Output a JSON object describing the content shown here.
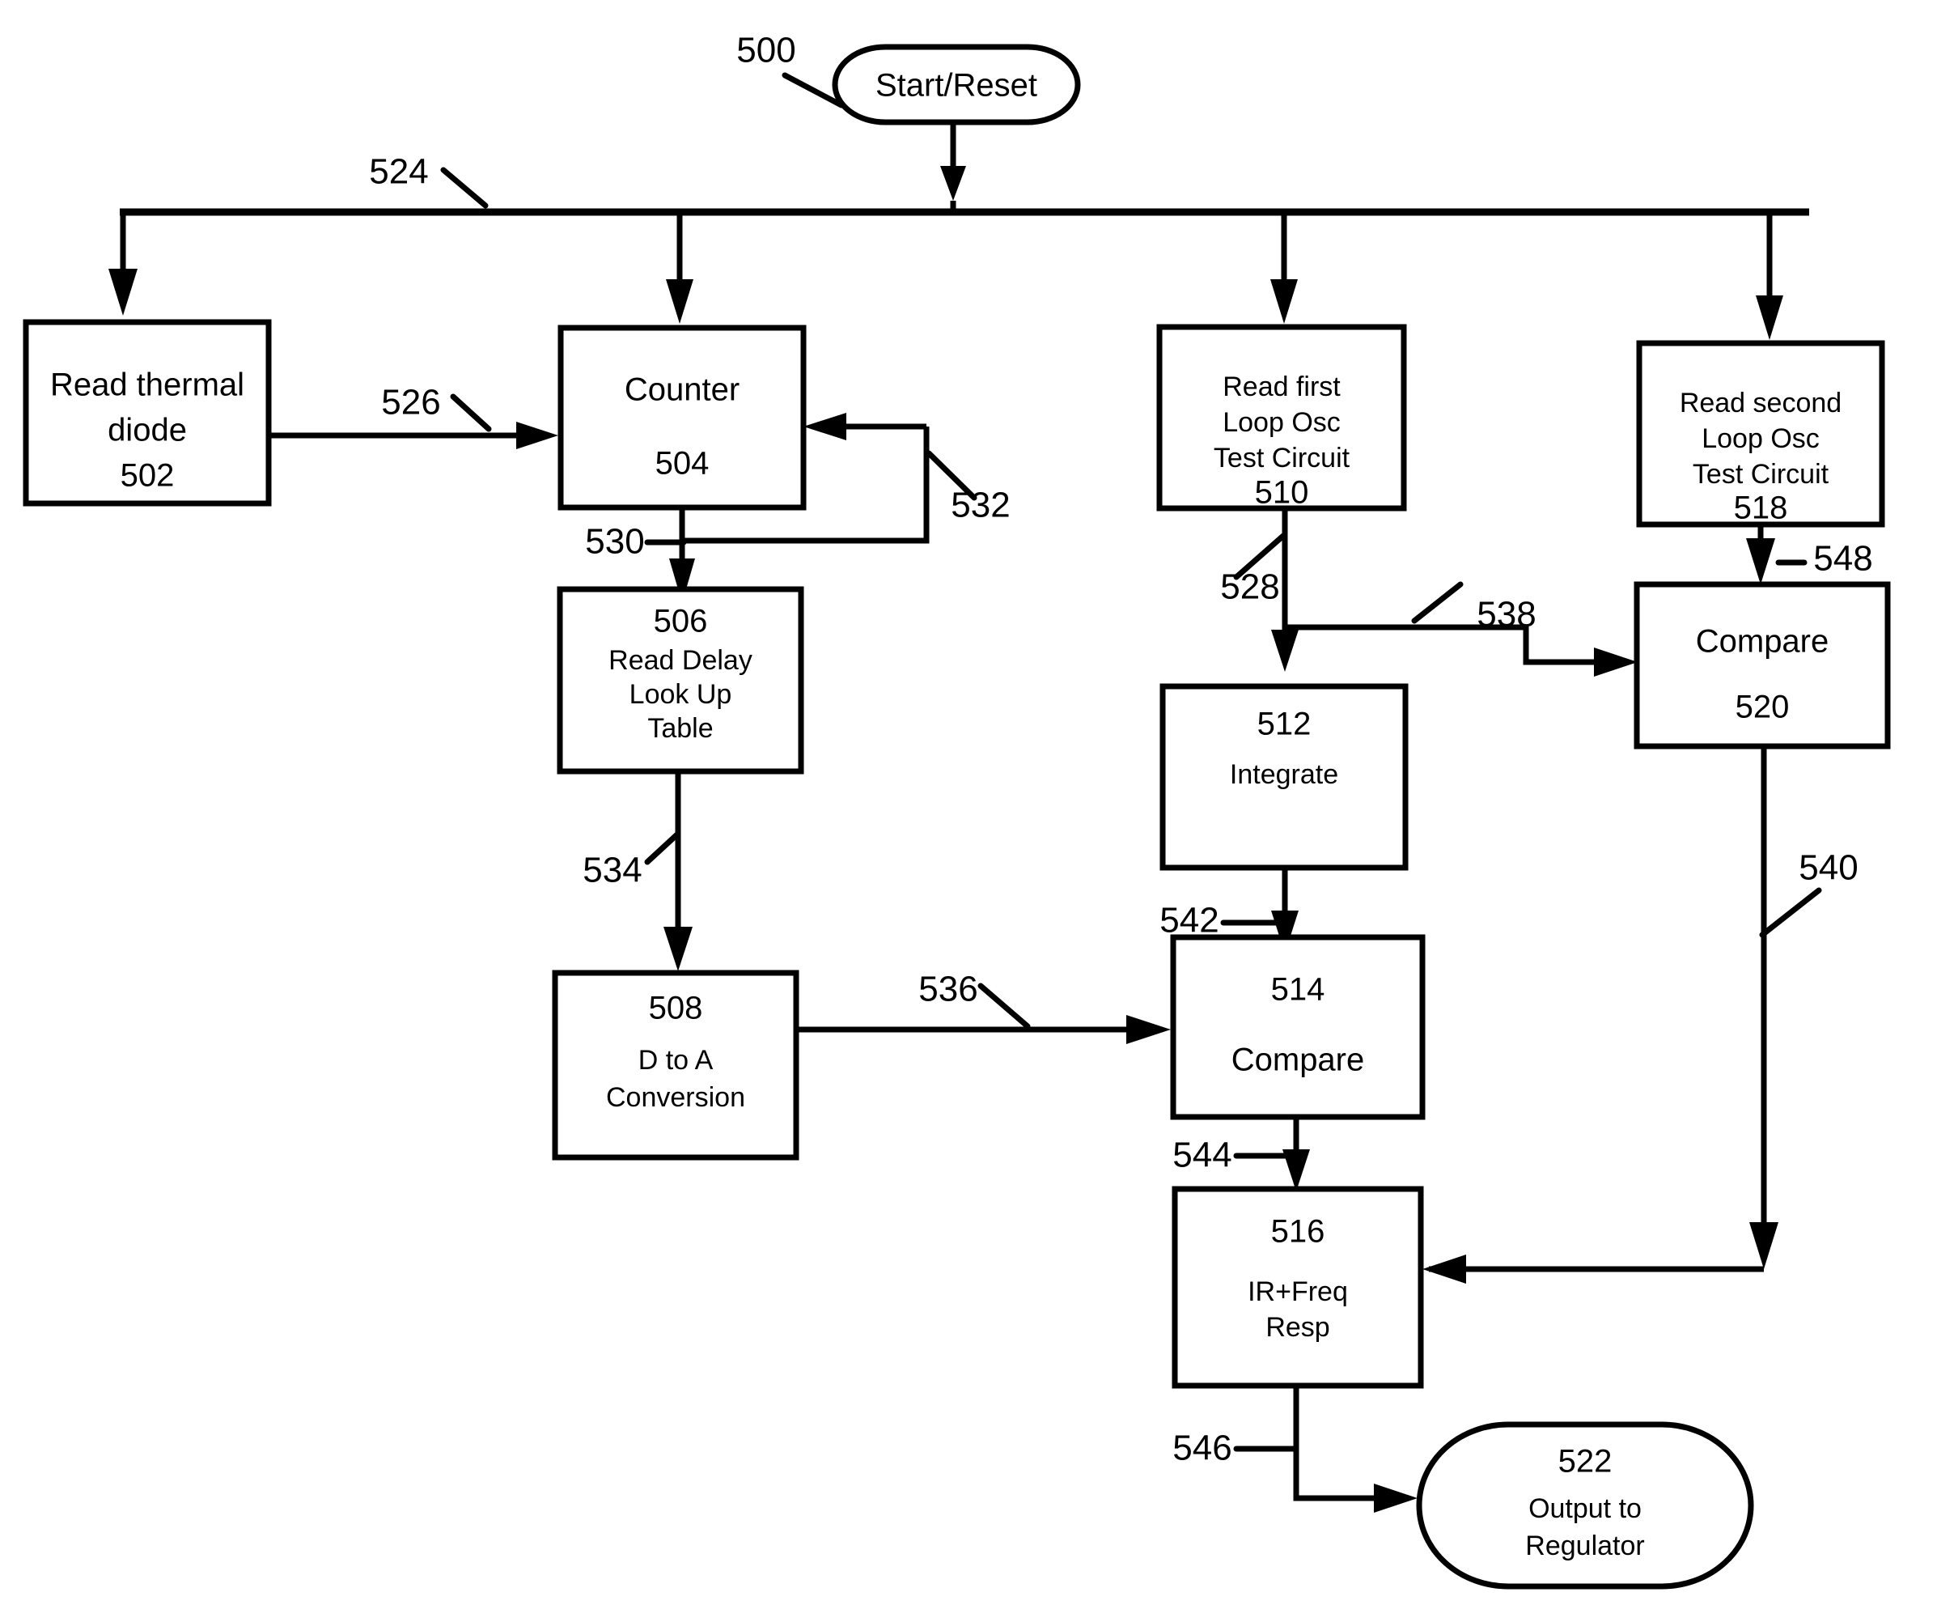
{
  "figure": {
    "type": "patent-flowchart",
    "figure_ref": "500"
  },
  "nodes": {
    "start": {
      "id": "500",
      "shape": "rounded-terminal",
      "label": "Start/Reset"
    },
    "n502": {
      "id": "502",
      "shape": "rectangle",
      "line1": "Read thermal",
      "line2": "diode",
      "number": "502"
    },
    "n504": {
      "id": "504",
      "shape": "rectangle",
      "label": "Counter",
      "number": "504"
    },
    "n506": {
      "id": "506",
      "shape": "rectangle",
      "number": "506",
      "line1": "Read Delay",
      "line2": "Look Up",
      "line3": "Table"
    },
    "n508": {
      "id": "508",
      "shape": "rectangle",
      "number": "508",
      "line1": "D to A",
      "line2": "Conversion"
    },
    "n510": {
      "id": "510",
      "shape": "rectangle",
      "line1": "Read first",
      "line2": "Loop Osc",
      "line3": "Test Circuit",
      "number": "510"
    },
    "n512": {
      "id": "512",
      "shape": "rectangle",
      "number": "512",
      "label": "Integrate"
    },
    "n514": {
      "id": "514",
      "shape": "rectangle",
      "number": "514",
      "label": "Compare"
    },
    "n516": {
      "id": "516",
      "shape": "rectangle",
      "number": "516",
      "line1": "IR+Freq",
      "line2": "Resp"
    },
    "n518": {
      "id": "518",
      "shape": "rectangle",
      "line1": "Read second",
      "line2": "Loop Osc",
      "line3": "Test Circuit",
      "number": "518"
    },
    "n520": {
      "id": "520",
      "shape": "rectangle",
      "label": "Compare",
      "number": "520"
    },
    "n522": {
      "id": "522",
      "shape": "rounded-terminal",
      "number": "522",
      "line1": "Output to",
      "line2": "Regulator"
    }
  },
  "edges": {
    "e524": {
      "ref": "524",
      "from": "start",
      "to": "bus"
    },
    "e526": {
      "ref": "526",
      "from": "502",
      "to": "504"
    },
    "e528": {
      "ref": "528",
      "from": "510",
      "to": "512"
    },
    "e530": {
      "ref": "530",
      "from": "504",
      "to": "506"
    },
    "e532": {
      "ref": "532",
      "from": "504-out",
      "to": "504-in"
    },
    "e534": {
      "ref": "534",
      "from": "506",
      "to": "508"
    },
    "e536": {
      "ref": "536",
      "from": "508",
      "to": "514"
    },
    "e538": {
      "ref": "538",
      "from": "510",
      "to": "520"
    },
    "e540": {
      "ref": "540",
      "from": "520",
      "to": "516"
    },
    "e542": {
      "ref": "542",
      "from": "512",
      "to": "514"
    },
    "e544": {
      "ref": "544",
      "from": "514",
      "to": "516"
    },
    "e546": {
      "ref": "546",
      "from": "516",
      "to": "522"
    },
    "e548": {
      "ref": "548",
      "from": "518",
      "to": "520"
    }
  },
  "colors": {
    "ink": "#000000",
    "paper": "#ffffff"
  }
}
